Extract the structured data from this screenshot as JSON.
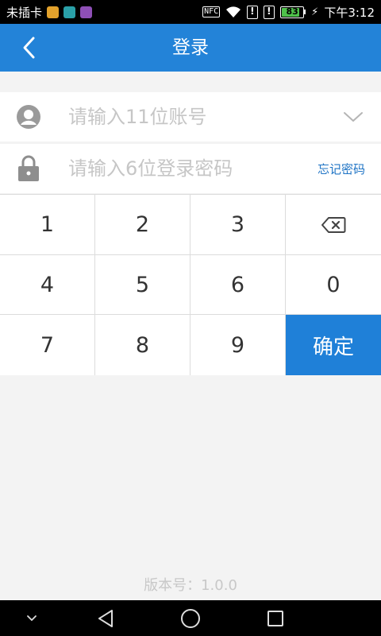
{
  "status_bar": {
    "carrier": "未插卡",
    "nfc": "NFC",
    "battery_level": "83",
    "battery_fraction": 0.83,
    "time": "下午3:12",
    "app_icon_colors": [
      "#e3a22c",
      "#2aa0a8",
      "#8e4fb6"
    ]
  },
  "header": {
    "title": "登录",
    "back_icon": "chevron-left-icon",
    "background": "#2383d8"
  },
  "form": {
    "account_placeholder": "请输入11位账号",
    "account_value": "",
    "password_placeholder": "请输入6位登录密码",
    "password_value": "",
    "forgot_password": "忘记密码",
    "account_icon": "avatar-icon",
    "password_icon": "lock-icon",
    "dropdown_icon": "chevron-down-icon"
  },
  "keypad": {
    "keys": [
      "1",
      "2",
      "3",
      "4",
      "5",
      "6",
      "0",
      "7",
      "8",
      "9"
    ],
    "delete_icon": "backspace-icon",
    "confirm_label": "确定",
    "confirm_color": "#1f80d8"
  },
  "footer": {
    "version": "版本号：1.0.0"
  },
  "nav_bar": {
    "icons": [
      "hide-keyboard-icon",
      "back-triangle-icon",
      "home-circle-icon",
      "recents-square-icon"
    ]
  }
}
